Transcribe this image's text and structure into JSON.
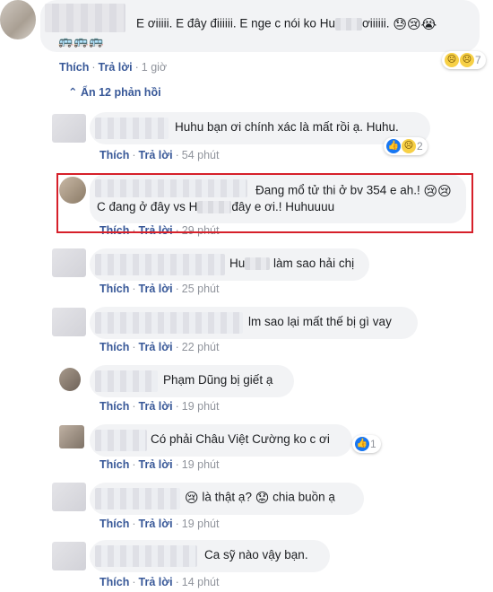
{
  "parent": {
    "text_a": "E ơiiiii. E đây điiiiii. E nge c nói ko Hu",
    "text_b": "ơiiiiii.",
    "emojis_inline": "😓😢😭",
    "emojis_row": "🚌🚌🚌",
    "like_label": "Thích",
    "reply_label": "Trả lời",
    "time": "1 giờ",
    "reaction_count": "7"
  },
  "replies_toggle": "Ẩn 12 phản hồi",
  "replies": [
    {
      "text": "Huhu bạn ơi chính xác là mất rồi ạ. Huhu.",
      "time": "54 phút",
      "reaction_count": "2"
    },
    {
      "text_line1": "Đang mổ tử thi ở bv 354 e ah.!",
      "text_line2a": "C đang ở đây vs H",
      "text_line2b": "đây e ơi.! Huhuuuu",
      "emojis": "😢😢",
      "time": "29 phút"
    },
    {
      "text_a": "Hu",
      "text_b": "làm sao hải chị",
      "time": "25 phút"
    },
    {
      "text": "lm sao lại mất thế bị gì vay",
      "time": "22 phút"
    },
    {
      "text": "Phạm Dũng bị giết ạ",
      "time": "19 phút"
    },
    {
      "text": "Có phải Châu Việt Cường ko c ơi",
      "time": "19 phút",
      "reaction_count": "1"
    },
    {
      "text_a": "là thật ạ?",
      "text_b": "chia buồn ạ",
      "emoji_a": "😢",
      "emoji_b": "😟",
      "time": "19 phút"
    },
    {
      "text": "Ca sỹ nào vậy bạn.",
      "time": "14 phút"
    }
  ],
  "common": {
    "like_label": "Thích",
    "reply_label": "Trả lời",
    "dot": "·"
  },
  "colors": {
    "link": "#385898",
    "bubble": "#f2f3f5",
    "highlight": "#d6202a",
    "like": "#1877f2"
  }
}
